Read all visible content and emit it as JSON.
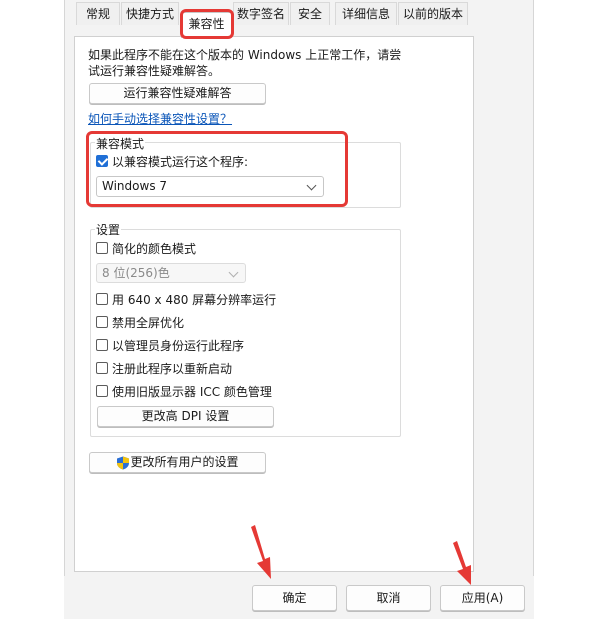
{
  "tabs": [
    {
      "label": "常规"
    },
    {
      "label": "快捷方式"
    },
    {
      "label": "兼容性"
    },
    {
      "label": "数字签名"
    },
    {
      "label": "安全"
    },
    {
      "label": "详细信息"
    },
    {
      "label": "以前的版本"
    }
  ],
  "active_tab": "兼容性",
  "description": "如果此程序不能在这个版本的 Windows 上正常工作，请尝试运行兼容性疑难解答。",
  "troubleshooter_button": "运行兼容性疑难解答",
  "manual_link": "如何手动选择兼容性设置？",
  "compat_mode": {
    "group_label": "兼容模式",
    "checkbox_label": "以兼容模式运行这个程序:",
    "checked": true,
    "selected_os": "Windows 7"
  },
  "settings": {
    "group_label": "设置",
    "reduced_color": {
      "label": "简化的颜色模式",
      "checked": false
    },
    "color_select": "8 位(256)色",
    "options": [
      {
        "label": "用 640 x 480 屏幕分辨率运行",
        "checked": false
      },
      {
        "label": "禁用全屏优化",
        "checked": false
      },
      {
        "label": "以管理员身份运行此程序",
        "checked": false
      },
      {
        "label": "注册此程序以重新启动",
        "checked": false
      },
      {
        "label": "使用旧版显示器 ICC 颜色管理",
        "checked": false
      }
    ],
    "dpi_button": "更改高 DPI 设置"
  },
  "all_users_button": "更改所有用户的设置",
  "footer": {
    "ok": "确定",
    "cancel": "取消",
    "apply": "应用(A)"
  },
  "colors": {
    "highlight": "#e53935",
    "checkbox_checked": "#1f6fd6",
    "link": "#0a55b8"
  }
}
